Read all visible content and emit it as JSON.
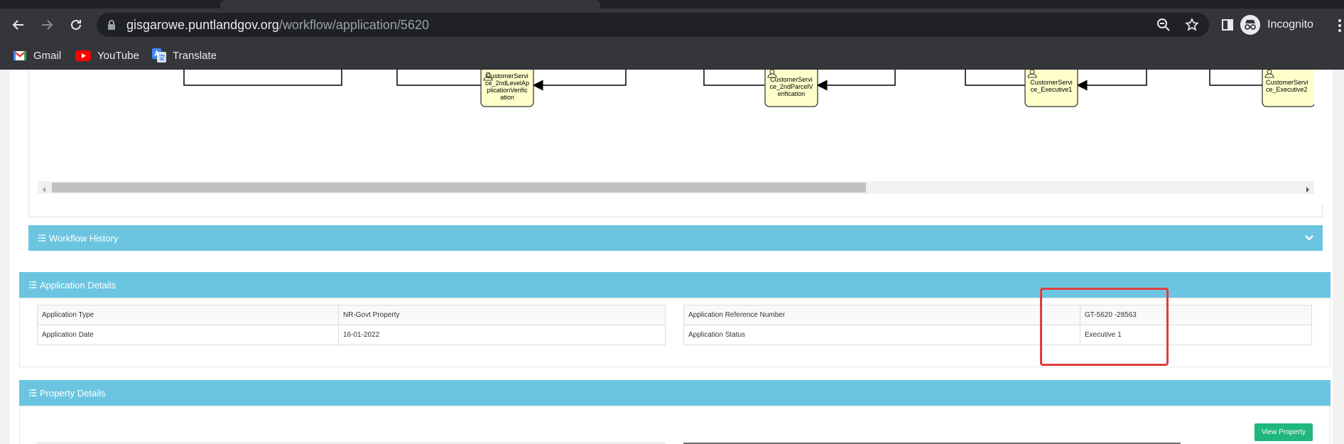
{
  "browser": {
    "url_host": "gisgarowe.puntlandgov.org",
    "url_path": "/workflow/application/5620",
    "profile_label": "Incognito",
    "bookmarks": [
      {
        "label": "Gmail"
      },
      {
        "label": "YouTube"
      },
      {
        "label": "Translate"
      }
    ]
  },
  "workflow": {
    "nodes": [
      {
        "lines": [
          "CustomerServi",
          "ce_2ndLevelAp",
          "plicationVerific",
          "ation"
        ]
      },
      {
        "lines": [
          "CustomerServi",
          "ce_2ndParcelV",
          "erification"
        ]
      },
      {
        "lines": [
          "CustomerServi",
          "ce_Executive1"
        ]
      },
      {
        "lines": [
          "CustomerServi",
          "ce_Executive2"
        ]
      }
    ]
  },
  "workflow_history": {
    "title": "Workflow History"
  },
  "application_details": {
    "title": "Application Details",
    "rows_left": [
      {
        "label": "Application Type",
        "value": "NR-Govt Property"
      },
      {
        "label": "Application Date",
        "value": "16-01-2022"
      }
    ],
    "rows_right": [
      {
        "label": "Application Reference Number",
        "value": "GT-5620 -28563"
      },
      {
        "label": "Application Status",
        "value": "Executive 1"
      }
    ]
  },
  "property_details": {
    "title": "Property Details",
    "view_button": "View Property"
  },
  "colors": {
    "section_header": "#6bc5e0",
    "task_fill": "#ffffcc",
    "highlight": "#e03c3c",
    "button_green": "#1fb77d"
  }
}
